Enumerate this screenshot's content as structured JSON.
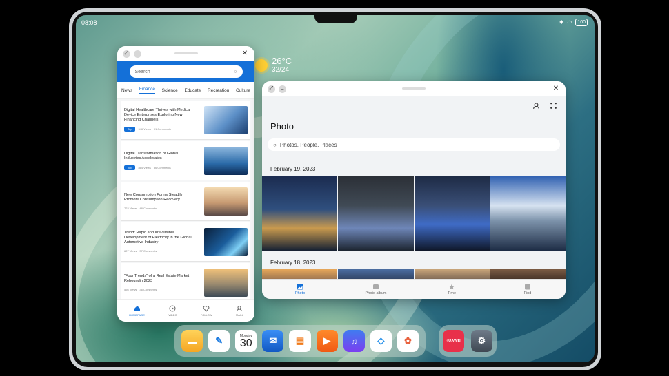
{
  "status_bar": {
    "time": "08:08",
    "battery": "100"
  },
  "weather": {
    "temperature": "26°C",
    "range": "32/24"
  },
  "news_app": {
    "search_placeholder": "Search",
    "tabs": [
      "News",
      "Finance",
      "Science",
      "Educate",
      "Recreation",
      "Culture"
    ],
    "active_tab": "Finance",
    "articles": [
      {
        "title": "Digital Healthcare Thrives with Medical Device Enterprises Exploring New Financing Channels",
        "tag": "Top",
        "views": "946 Views",
        "comments": "91 Comments"
      },
      {
        "title": "Digital Transformation of Global Industries Accelerates",
        "tag": "Top",
        "views": "864 Views",
        "comments": "86 Comments"
      },
      {
        "title": "New Consumption Forms Steadily Promote Consumption Recovery",
        "tag": "",
        "views": "723 Views",
        "comments": "48 Comments"
      },
      {
        "title": "Trend: Rapid and Irreversible Development of Electricity in the Global Automotive Industry",
        "tag": "",
        "views": "627 Views",
        "comments": "37 Comments"
      },
      {
        "title": "\"Four Trends\" of a Real Estate Market Reboundin 2023",
        "tag": "",
        "views": "556 Views",
        "comments": "36 Comments"
      }
    ],
    "nav": [
      "HOMEPAGE",
      "VIDEO",
      "FOLLOW",
      "MAIN"
    ]
  },
  "photo_app": {
    "title": "Photo",
    "search_placeholder": "Photos, People, Places",
    "groups": [
      {
        "date": "February 19, 2023"
      },
      {
        "date": "February 18, 2023"
      }
    ],
    "nav": [
      "Photo",
      "Photo album",
      "Time",
      "Find"
    ]
  },
  "dock": {
    "calendar_day": "Monday",
    "calendar_date": "30",
    "huawei_label": "HUAWEI"
  }
}
